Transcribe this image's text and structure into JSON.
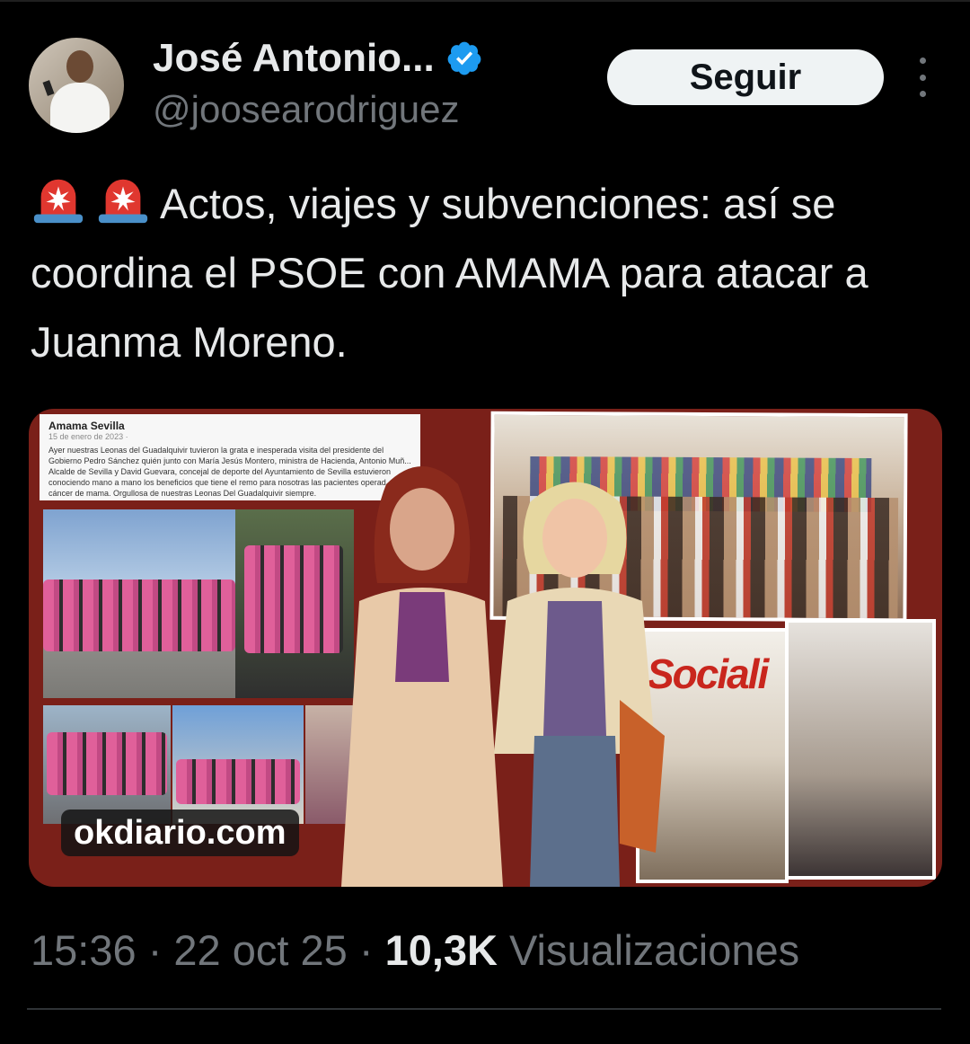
{
  "author": {
    "name": "José Antonio...",
    "handle": "@joosearodriguez",
    "verified": true
  },
  "actions": {
    "follow_label": "Seguir",
    "more_icon": "more-vertical-icon"
  },
  "tweet": {
    "text": "Actos, viajes y subvenciones: así se coordina el PSOE con AMAMA para atacar a Juanma Moreno.",
    "emoji": [
      "rotating-light-icon",
      "rotating-light-icon"
    ]
  },
  "media": {
    "watermark": "okdiario.com",
    "facebook_post": {
      "name": "Amama Sevilla",
      "date": "15 de enero de 2023 ·",
      "text": "Ayer nuestras Leonas del Guadalquivir tuvieron la grata e inesperada visita del presidente del Gobierno Pedro Sánchez quién junto con María Jesús Montero, ministra de Hacienda, Antonio Muñ... Alcalde de Sevilla y David Guevara, concejal de deporte del Ayuntamiento de Sevilla estuvieron conociendo mano a mano los beneficios que tiene el remo para nosotras las pacientes operad... cáncer de mama. Orgullosa de nuestras Leonas Del Guadalquivir siempre."
    },
    "banner_text": "Sociali"
  },
  "footer": {
    "time": "15:36",
    "separator": "·",
    "date": "22 oct 25",
    "views_count": "10,3K",
    "views_label": "Visualizaciones"
  },
  "colors": {
    "background": "#000000",
    "text": "#e7e9ea",
    "muted": "#71767b",
    "verified": "#1d9bf0",
    "media_bg": "#7a2019"
  }
}
